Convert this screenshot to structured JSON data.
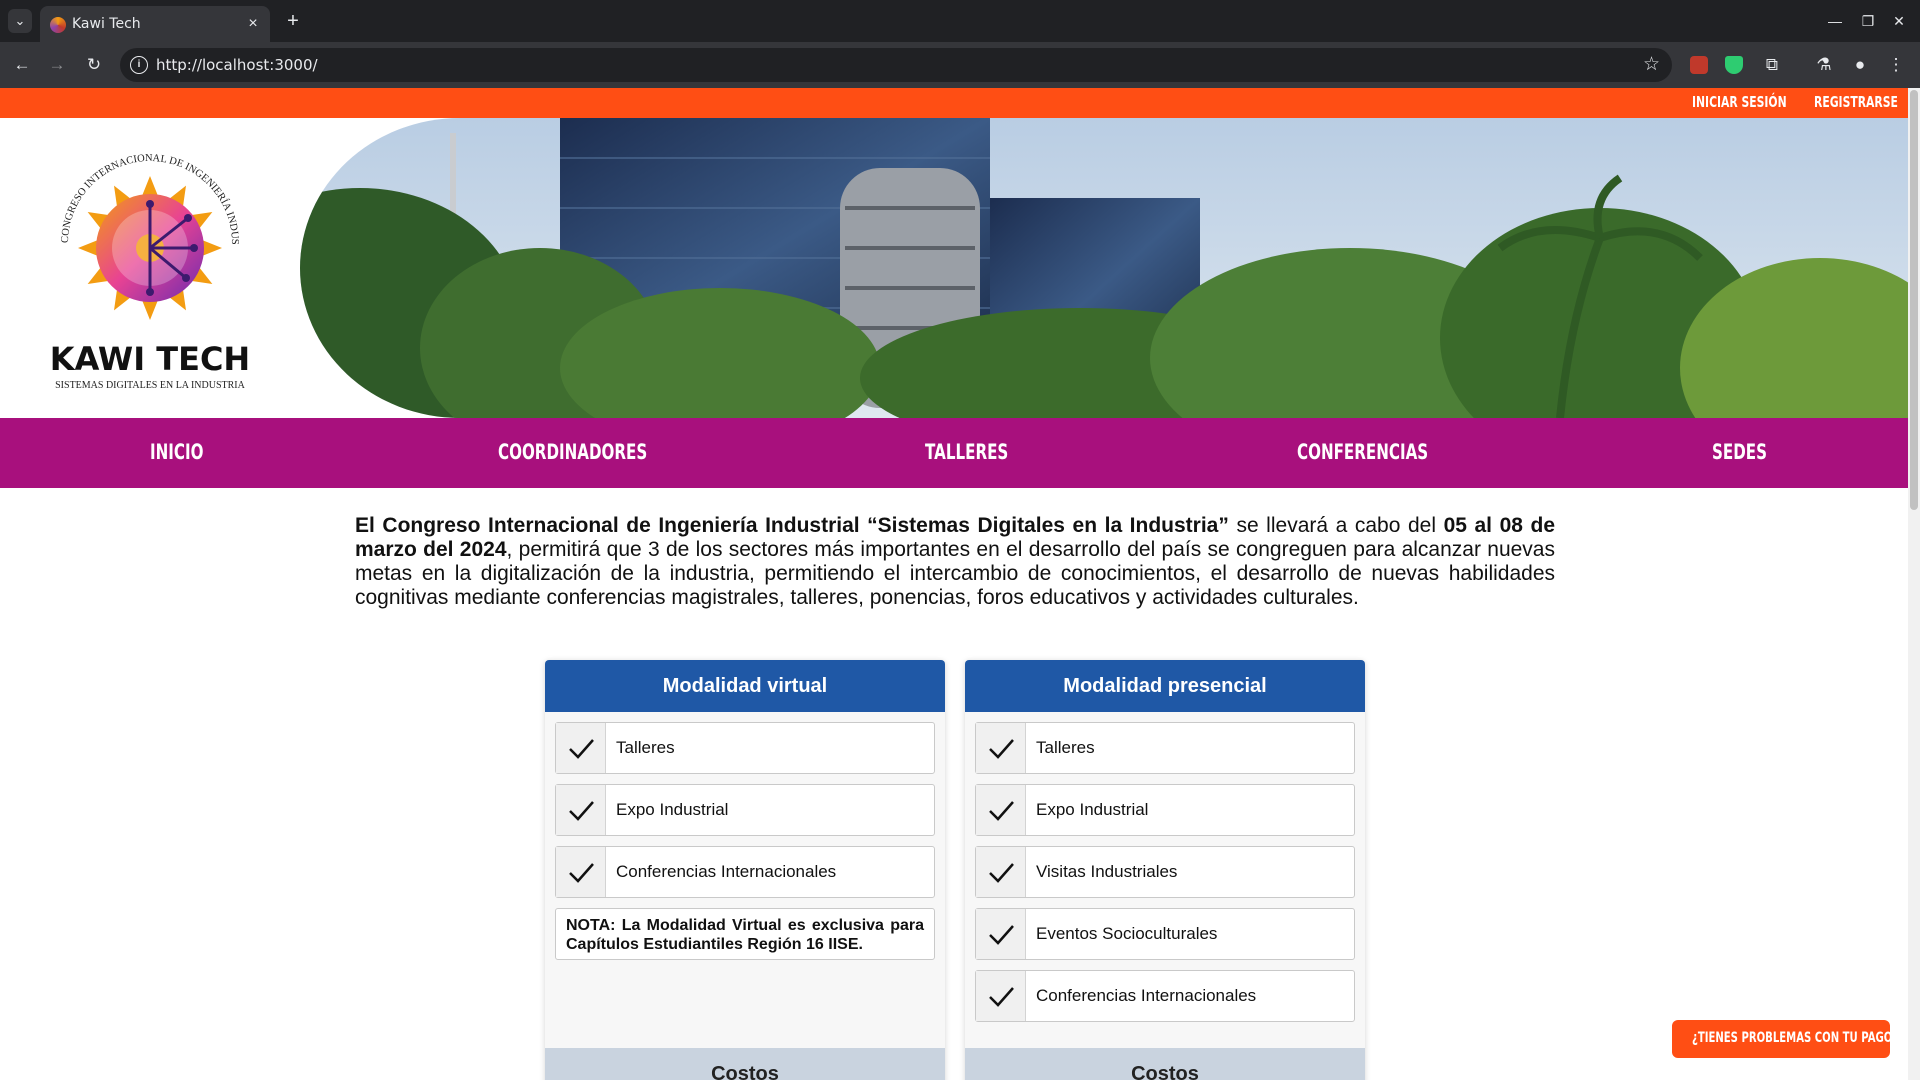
{
  "browser": {
    "tab_title": "Kawi Tech",
    "url": "http://localhost:3000/"
  },
  "topbar": {
    "login": "INICIAR SESIÓN",
    "register": "REGISTRARSE"
  },
  "logo": {
    "name": "KAWI TECH",
    "ring_text": "CONGRESO INTERNACIONAL DE INGENIERÍA INDUSTRIAL",
    "subtitle": "SISTEMAS DIGITALES EN LA INDUSTRIA"
  },
  "nav": {
    "items": [
      "INICIO",
      "COORDINADORES",
      "TALLERES",
      "CONFERENCIAS",
      "SEDES"
    ]
  },
  "intro": {
    "bold1": "El Congreso Internacional de Ingeniería Industrial “Sistemas Digitales en la Industria”",
    "text1": " se llevará a cabo del ",
    "bold2": "05 al 08 de marzo del 2024",
    "text2": ", permitirá que 3 de los sectores más importantes en el desarrollo del país se congreguen para alcanzar nuevas metas en la digitalización de la industria, permitiendo el intercambio de conocimientos, el desarrollo de nuevas habilidades cognitivas mediante conferencias magistrales, talleres, ponencias, foros educativos y actividades culturales."
  },
  "virtual": {
    "title": "Modalidad virtual",
    "items": [
      "Talleres",
      "Expo Industrial",
      "Conferencias Internacionales"
    ],
    "note": "NOTA: La Modalidad Virtual es exclusiva para Capítulos Estudiantiles Región 16 IISE.",
    "costs": "Costos"
  },
  "presencial": {
    "title": "Modalidad presencial",
    "items": [
      "Talleres",
      "Expo Industrial",
      "Visitas Industriales",
      "Eventos Socioculturales",
      "Conferencias Internacionales"
    ],
    "costs": "Costos"
  },
  "help_button": "¿TIENES PROBLEMAS CON TU PAGO?",
  "colors": {
    "topbar": "#ff4e14",
    "nav": "#a8107d",
    "card_header": "#1f58a6",
    "costs_band": "#c9d3df"
  }
}
